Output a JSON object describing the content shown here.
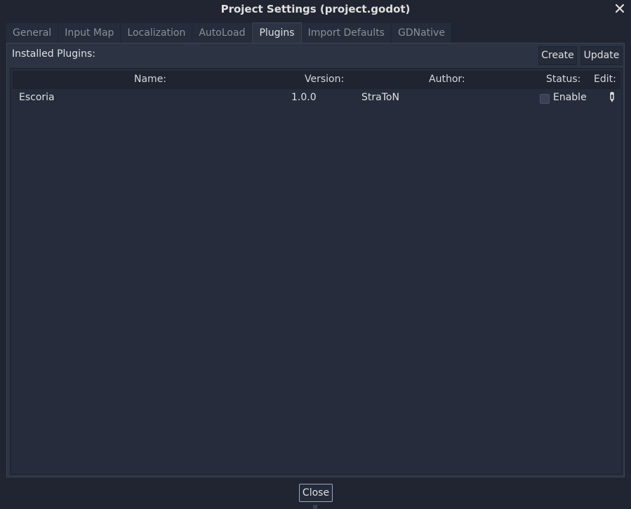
{
  "window": {
    "title": "Project Settings (project.godot)",
    "close_icon": "close-icon"
  },
  "tabs": [
    {
      "label": "General",
      "active": false
    },
    {
      "label": "Input Map",
      "active": false
    },
    {
      "label": "Localization",
      "active": false
    },
    {
      "label": "AutoLoad",
      "active": false
    },
    {
      "label": "Plugins",
      "active": true
    },
    {
      "label": "Import Defaults",
      "active": false
    },
    {
      "label": "GDNative",
      "active": false
    }
  ],
  "plugins": {
    "installed_label": "Installed Plugins:",
    "create_label": "Create",
    "update_label": "Update",
    "columns": {
      "name": "Name:",
      "version": "Version:",
      "author": "Author:",
      "status": "Status:",
      "edit": "Edit:"
    },
    "rows": [
      {
        "name": "Escoria",
        "version": "1.0.0",
        "author": "StraToN",
        "enabled": false,
        "status_label": "Enable",
        "edit_icon": "edit-icon"
      }
    ]
  },
  "footer": {
    "close_label": "Close"
  },
  "colors": {
    "background": "#202531",
    "panel": "#2c3444",
    "tree": "#262c3b",
    "text": "#e0e0e0",
    "muted_text": "#8a8f9a"
  }
}
